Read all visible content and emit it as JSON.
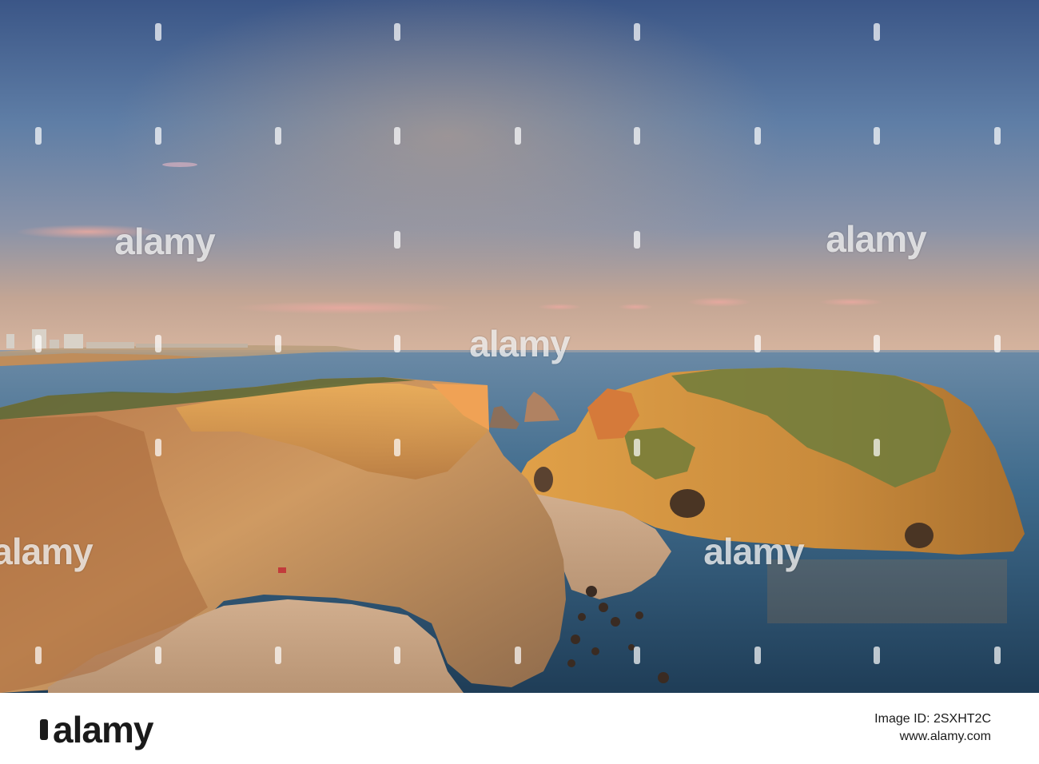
{
  "watermark": {
    "text": "alamy",
    "marks": [
      {
        "col": 0,
        "row": 0
      },
      {
        "col": 1,
        "row": 0
      },
      {
        "col": 2,
        "row": 0
      },
      {
        "col": 3,
        "row": 0
      },
      {
        "col": 4,
        "row": 0
      }
    ]
  },
  "footer": {
    "logo_text": "alamy",
    "image_id_label": "Image ID: 2SXHT2C",
    "site": "www.alamy.com"
  },
  "colors": {
    "sky_top": "#3f5a86",
    "sky_mid": "#6d86a8",
    "sky_horizon": "#c9a58e",
    "sea": "#4a6f93",
    "sea_deep": "#1d3b55",
    "cliff_lit": "#d99a4e",
    "cliff_shadow": "#8a6a4a",
    "sand": "#c9a27e",
    "vegetation": "#6c7a3a"
  }
}
